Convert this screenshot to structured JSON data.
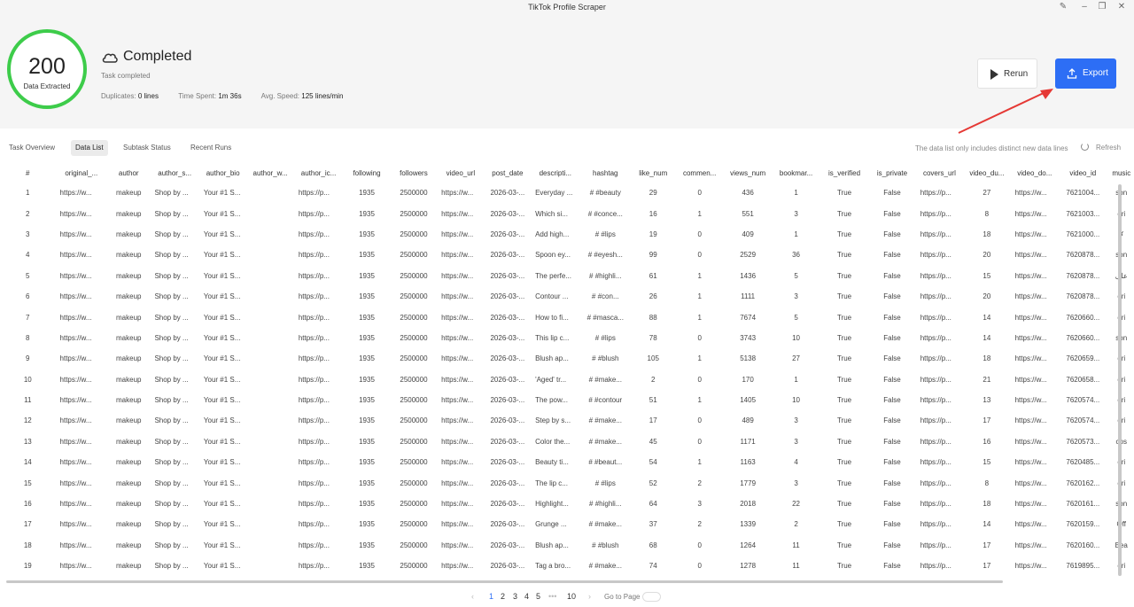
{
  "window": {
    "title": "TikTok Profile Scraper"
  },
  "summary": {
    "count": "200",
    "count_label": "Data Extracted",
    "status": "Completed",
    "subtitle": "Task completed",
    "duplicates_label": "Duplicates:",
    "duplicates_value": "0 lines",
    "time_label": "Time Spent:",
    "time_value": "1m 36s",
    "speed_label": "Avg. Speed:",
    "speed_value": "125 lines/min"
  },
  "actions": {
    "rerun_label": "Rerun",
    "export_label": "Export"
  },
  "colors": {
    "ring": "#3dcc4a",
    "export_bg": "#2d6ef5",
    "annotation_arrow": "#e53935",
    "pager_active": "#2d6ef5"
  },
  "tabs": [
    {
      "label": "Task Overview"
    },
    {
      "label": "Data List"
    },
    {
      "label": "Subtask Status"
    },
    {
      "label": "Recent Runs"
    }
  ],
  "active_tab": "Data List",
  "list_note": "The data list only includes distinct new data lines",
  "refresh_label": "Refresh",
  "columns": [
    "#",
    "original_...",
    "author",
    "author_s...",
    "author_bio",
    "author_w...",
    "author_ic...",
    "following",
    "followers",
    "video_url",
    "post_date",
    "descripti...",
    "hashtag",
    "like_num",
    "commen...",
    "views_num",
    "bookmar...",
    "is_verified",
    "is_private",
    "covers_url",
    "video_du...",
    "video_do...",
    "video_id",
    "music"
  ],
  "rows": [
    [
      "1",
      "https://w...",
      "makeup",
      "Shop by ...",
      "Your #1 S...",
      "",
      "https://p...",
      "1935",
      "2500000",
      "https://w...",
      "2026-03-...",
      "Everyday ...",
      "# #beauty",
      "29",
      "0",
      "436",
      "1",
      "True",
      "False",
      "https://p...",
      "27",
      "https://w...",
      "7621004...",
      "son"
    ],
    [
      "2",
      "https://w...",
      "makeup",
      "Shop by ...",
      "Your #1 S...",
      "",
      "https://p...",
      "1935",
      "2500000",
      "https://w...",
      "2026-03-...",
      "Which si...",
      "# #conce...",
      "16",
      "1",
      "551",
      "3",
      "True",
      "False",
      "https://p...",
      "8",
      "https://w...",
      "7621003...",
      "ori"
    ],
    [
      "3",
      "https://w...",
      "makeup",
      "Shop by ...",
      "Your #1 S...",
      "",
      "https://p...",
      "1935",
      "2500000",
      "https://w...",
      "2026-03-...",
      "Add high...",
      "# #lips",
      "19",
      "0",
      "409",
      "1",
      "True",
      "False",
      "https://p...",
      "18",
      "https://w...",
      "7621000...",
      "✗"
    ],
    [
      "4",
      "https://w...",
      "makeup",
      "Shop by ...",
      "Your #1 S...",
      "",
      "https://p...",
      "1935",
      "2500000",
      "https://w...",
      "2026-03-...",
      "Spoon ey...",
      "# #eyesh...",
      "99",
      "0",
      "2529",
      "36",
      "True",
      "False",
      "https://p...",
      "20",
      "https://w...",
      "7620878...",
      "son"
    ],
    [
      "5",
      "https://w...",
      "makeup",
      "Shop by ...",
      "Your #1 S...",
      "",
      "https://p...",
      "1935",
      "2500000",
      "https://w...",
      "2026-03-...",
      "The perfe...",
      "# #highli...",
      "61",
      "1",
      "1436",
      "5",
      "True",
      "False",
      "https://p...",
      "15",
      "https://w...",
      "7620878...",
      "علی"
    ],
    [
      "6",
      "https://w...",
      "makeup",
      "Shop by ...",
      "Your #1 S...",
      "",
      "https://p...",
      "1935",
      "2500000",
      "https://w...",
      "2026-03-...",
      "Contour ...",
      "# #con...",
      "26",
      "1",
      "1111",
      "3",
      "True",
      "False",
      "https://p...",
      "20",
      "https://w...",
      "7620878...",
      "ori"
    ],
    [
      "7",
      "https://w...",
      "makeup",
      "Shop by ...",
      "Your #1 S...",
      "",
      "https://p...",
      "1935",
      "2500000",
      "https://w...",
      "2026-03-...",
      "How to fi...",
      "# #masca...",
      "88",
      "1",
      "7674",
      "5",
      "True",
      "False",
      "https://p...",
      "14",
      "https://w...",
      "7620660...",
      "ori"
    ],
    [
      "8",
      "https://w...",
      "makeup",
      "Shop by ...",
      "Your #1 S...",
      "",
      "https://p...",
      "1935",
      "2500000",
      "https://w...",
      "2026-03-...",
      "This lip c...",
      "# #lips",
      "78",
      "0",
      "3743",
      "10",
      "True",
      "False",
      "https://p...",
      "14",
      "https://w...",
      "7620660...",
      "son"
    ],
    [
      "9",
      "https://w...",
      "makeup",
      "Shop by ...",
      "Your #1 S...",
      "",
      "https://p...",
      "1935",
      "2500000",
      "https://w...",
      "2026-03-...",
      "Blush ap...",
      "# #blush",
      "105",
      "1",
      "5138",
      "27",
      "True",
      "False",
      "https://p...",
      "18",
      "https://w...",
      "7620659...",
      "ori"
    ],
    [
      "10",
      "https://w...",
      "makeup",
      "Shop by ...",
      "Your #1 S...",
      "",
      "https://p...",
      "1935",
      "2500000",
      "https://w...",
      "2026-03-...",
      "'Aged' tr...",
      "# #make...",
      "2",
      "0",
      "170",
      "1",
      "True",
      "False",
      "https://p...",
      "21",
      "https://w...",
      "7620658...",
      "ori"
    ],
    [
      "11",
      "https://w...",
      "makeup",
      "Shop by ...",
      "Your #1 S...",
      "",
      "https://p...",
      "1935",
      "2500000",
      "https://w...",
      "2026-03-...",
      "The pow...",
      "# #contour",
      "51",
      "1",
      "1405",
      "10",
      "True",
      "False",
      "https://p...",
      "13",
      "https://w...",
      "7620574...",
      "ori"
    ],
    [
      "12",
      "https://w...",
      "makeup",
      "Shop by ...",
      "Your #1 S...",
      "",
      "https://p...",
      "1935",
      "2500000",
      "https://w...",
      "2026-03-...",
      "Step by s...",
      "# #make...",
      "17",
      "0",
      "489",
      "3",
      "True",
      "False",
      "https://p...",
      "17",
      "https://w...",
      "7620574...",
      "ori"
    ],
    [
      "13",
      "https://w...",
      "makeup",
      "Shop by ...",
      "Your #1 S...",
      "",
      "https://p...",
      "1935",
      "2500000",
      "https://w...",
      "2026-03-...",
      "Color the...",
      "# #make...",
      "45",
      "0",
      "1171",
      "3",
      "True",
      "False",
      "https://p...",
      "16",
      "https://w...",
      "7620573...",
      "cos"
    ],
    [
      "14",
      "https://w...",
      "makeup",
      "Shop by ...",
      "Your #1 S...",
      "",
      "https://p...",
      "1935",
      "2500000",
      "https://w...",
      "2026-03-...",
      "Beauty ti...",
      "# #beaut...",
      "54",
      "1",
      "1163",
      "4",
      "True",
      "False",
      "https://p...",
      "15",
      "https://w...",
      "7620485...",
      "ori"
    ],
    [
      "15",
      "https://w...",
      "makeup",
      "Shop by ...",
      "Your #1 S...",
      "",
      "https://p...",
      "1935",
      "2500000",
      "https://w...",
      "2026-03-...",
      "The lip c...",
      "# #lips",
      "52",
      "2",
      "1779",
      "3",
      "True",
      "False",
      "https://p...",
      "8",
      "https://w...",
      "7620162...",
      "ori"
    ],
    [
      "16",
      "https://w...",
      "makeup",
      "Shop by ...",
      "Your #1 S...",
      "",
      "https://p...",
      "1935",
      "2500000",
      "https://w...",
      "2026-03-...",
      "Highlight...",
      "# #highli...",
      "64",
      "3",
      "2018",
      "22",
      "True",
      "False",
      "https://p...",
      "18",
      "https://w...",
      "7620161...",
      "son"
    ],
    [
      "17",
      "https://w...",
      "makeup",
      "Shop by ...",
      "Your #1 S...",
      "",
      "https://p...",
      "1935",
      "2500000",
      "https://w...",
      "2026-03-...",
      "Grunge ...",
      "# #make...",
      "37",
      "2",
      "1339",
      "2",
      "True",
      "False",
      "https://p...",
      "14",
      "https://w...",
      "7620159...",
      "Off"
    ],
    [
      "18",
      "https://w...",
      "makeup",
      "Shop by ...",
      "Your #1 S...",
      "",
      "https://p...",
      "1935",
      "2500000",
      "https://w...",
      "2026-03-...",
      "Blush ap...",
      "# #blush",
      "68",
      "0",
      "1264",
      "11",
      "True",
      "False",
      "https://p...",
      "17",
      "https://w...",
      "7620160...",
      "Bea"
    ],
    [
      "19",
      "https://w...",
      "makeup",
      "Shop by ...",
      "Your #1 S...",
      "",
      "https://p...",
      "1935",
      "2500000",
      "https://w...",
      "2026-03-...",
      "Tag a bro...",
      "# #make...",
      "74",
      "0",
      "1278",
      "11",
      "True",
      "False",
      "https://p...",
      "17",
      "https://w...",
      "7619895...",
      "ori"
    ]
  ],
  "pagination": {
    "prev": "‹",
    "pages": [
      "1",
      "2",
      "3",
      "4",
      "5"
    ],
    "ellipsis": "•••",
    "last": "10",
    "next": "›",
    "current": "1",
    "goto_label": "Go to Page"
  },
  "icons": {
    "cloud": "cloud-icon",
    "rerun": "play-icon",
    "export": "upload-icon",
    "refresh": "refresh-icon"
  }
}
